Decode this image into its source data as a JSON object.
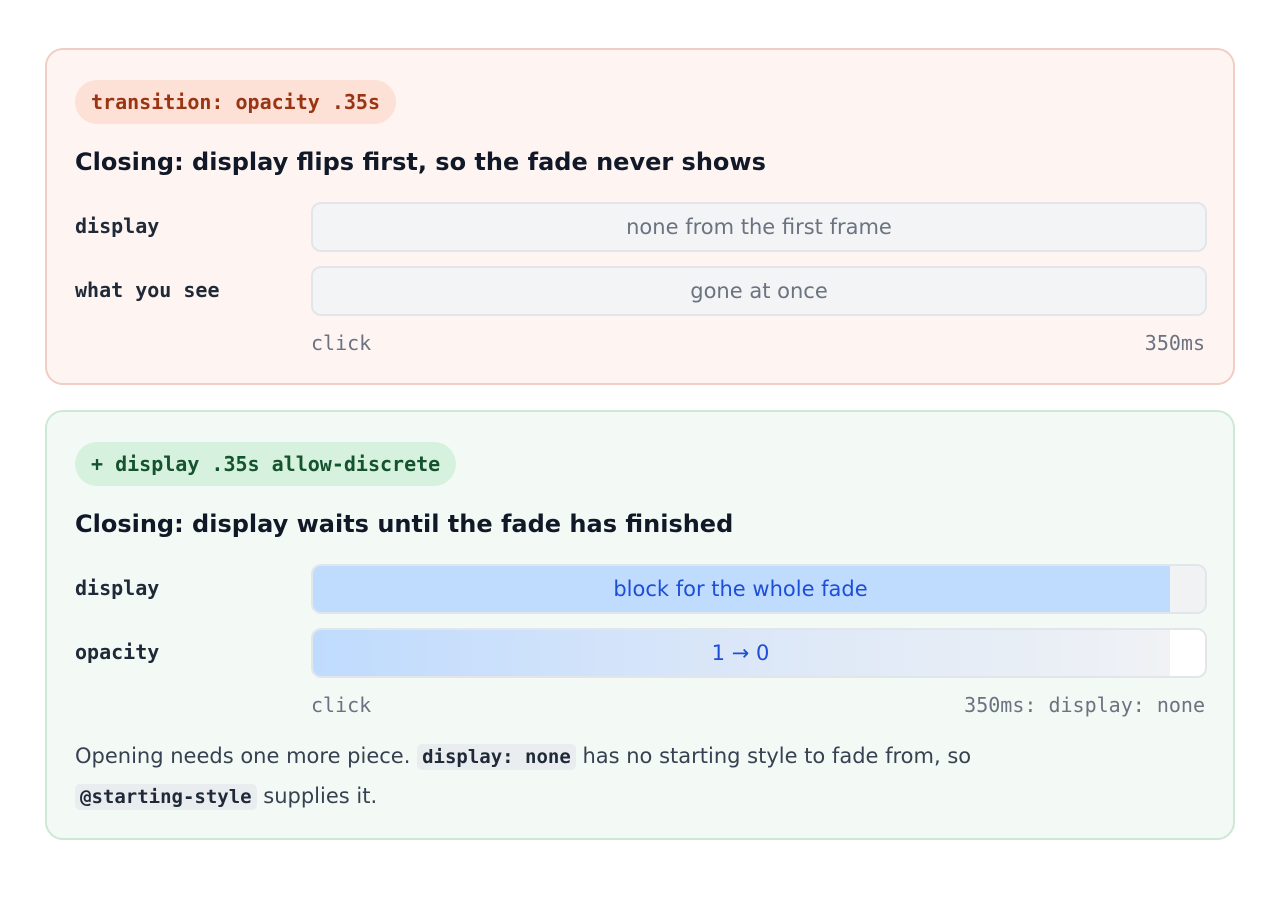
{
  "before": {
    "pill": "transition: opacity .35s",
    "heading": "Closing: display flips first, so the fade never shows",
    "rows": [
      {
        "label": "display",
        "bar_text": "none from the first frame"
      },
      {
        "label": "what you see",
        "bar_text": "gone at once"
      }
    ],
    "axis_start": "click",
    "axis_end": "350ms"
  },
  "after": {
    "pill": "+ display .35s allow-discrete",
    "heading": "Closing: display waits until the fade has finished",
    "rows": [
      {
        "label": "display",
        "bar_text": "block for the whole fade"
      },
      {
        "label": "opacity",
        "bar_text": "1 → 0"
      }
    ],
    "axis_start": "click",
    "axis_end": "350ms: display: none",
    "note": {
      "part1": "Opening needs one more piece. ",
      "code1": "display: none",
      "part2": " has no starting style to fade from, so ",
      "code2": "@starting-style",
      "part3": " supplies it."
    }
  },
  "colors": {
    "bad_bg": "#fef5f3",
    "good_bg": "#f3faf5",
    "blue_fill": "#bfdbfe",
    "blue_text": "#1d4ed8"
  }
}
